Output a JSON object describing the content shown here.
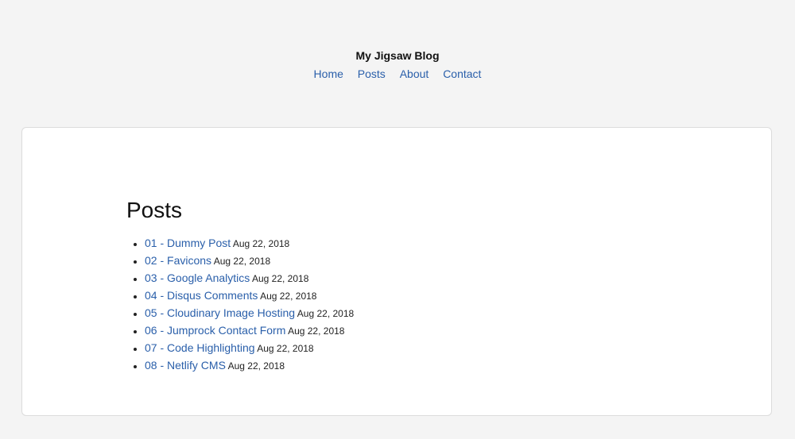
{
  "site": {
    "title": "My Jigsaw Blog"
  },
  "nav": {
    "items": [
      {
        "label": "Home"
      },
      {
        "label": "Posts"
      },
      {
        "label": "About"
      },
      {
        "label": "Contact"
      }
    ]
  },
  "main": {
    "heading": "Posts",
    "posts": [
      {
        "title": "01 - Dummy Post",
        "date": "Aug 22, 2018"
      },
      {
        "title": "02 - Favicons",
        "date": "Aug 22, 2018"
      },
      {
        "title": "03 - Google Analytics",
        "date": "Aug 22, 2018"
      },
      {
        "title": "04 - Disqus Comments",
        "date": "Aug 22, 2018"
      },
      {
        "title": "05 - Cloudinary Image Hosting",
        "date": "Aug 22, 2018"
      },
      {
        "title": "06 - Jumprock Contact Form",
        "date": "Aug 22, 2018"
      },
      {
        "title": "07 - Code Highlighting",
        "date": "Aug 22, 2018"
      },
      {
        "title": "08 - Netlify CMS",
        "date": "Aug 22, 2018"
      }
    ]
  },
  "colors": {
    "link": "#2a5faa",
    "background": "#f4f4f4",
    "card": "#ffffff"
  }
}
